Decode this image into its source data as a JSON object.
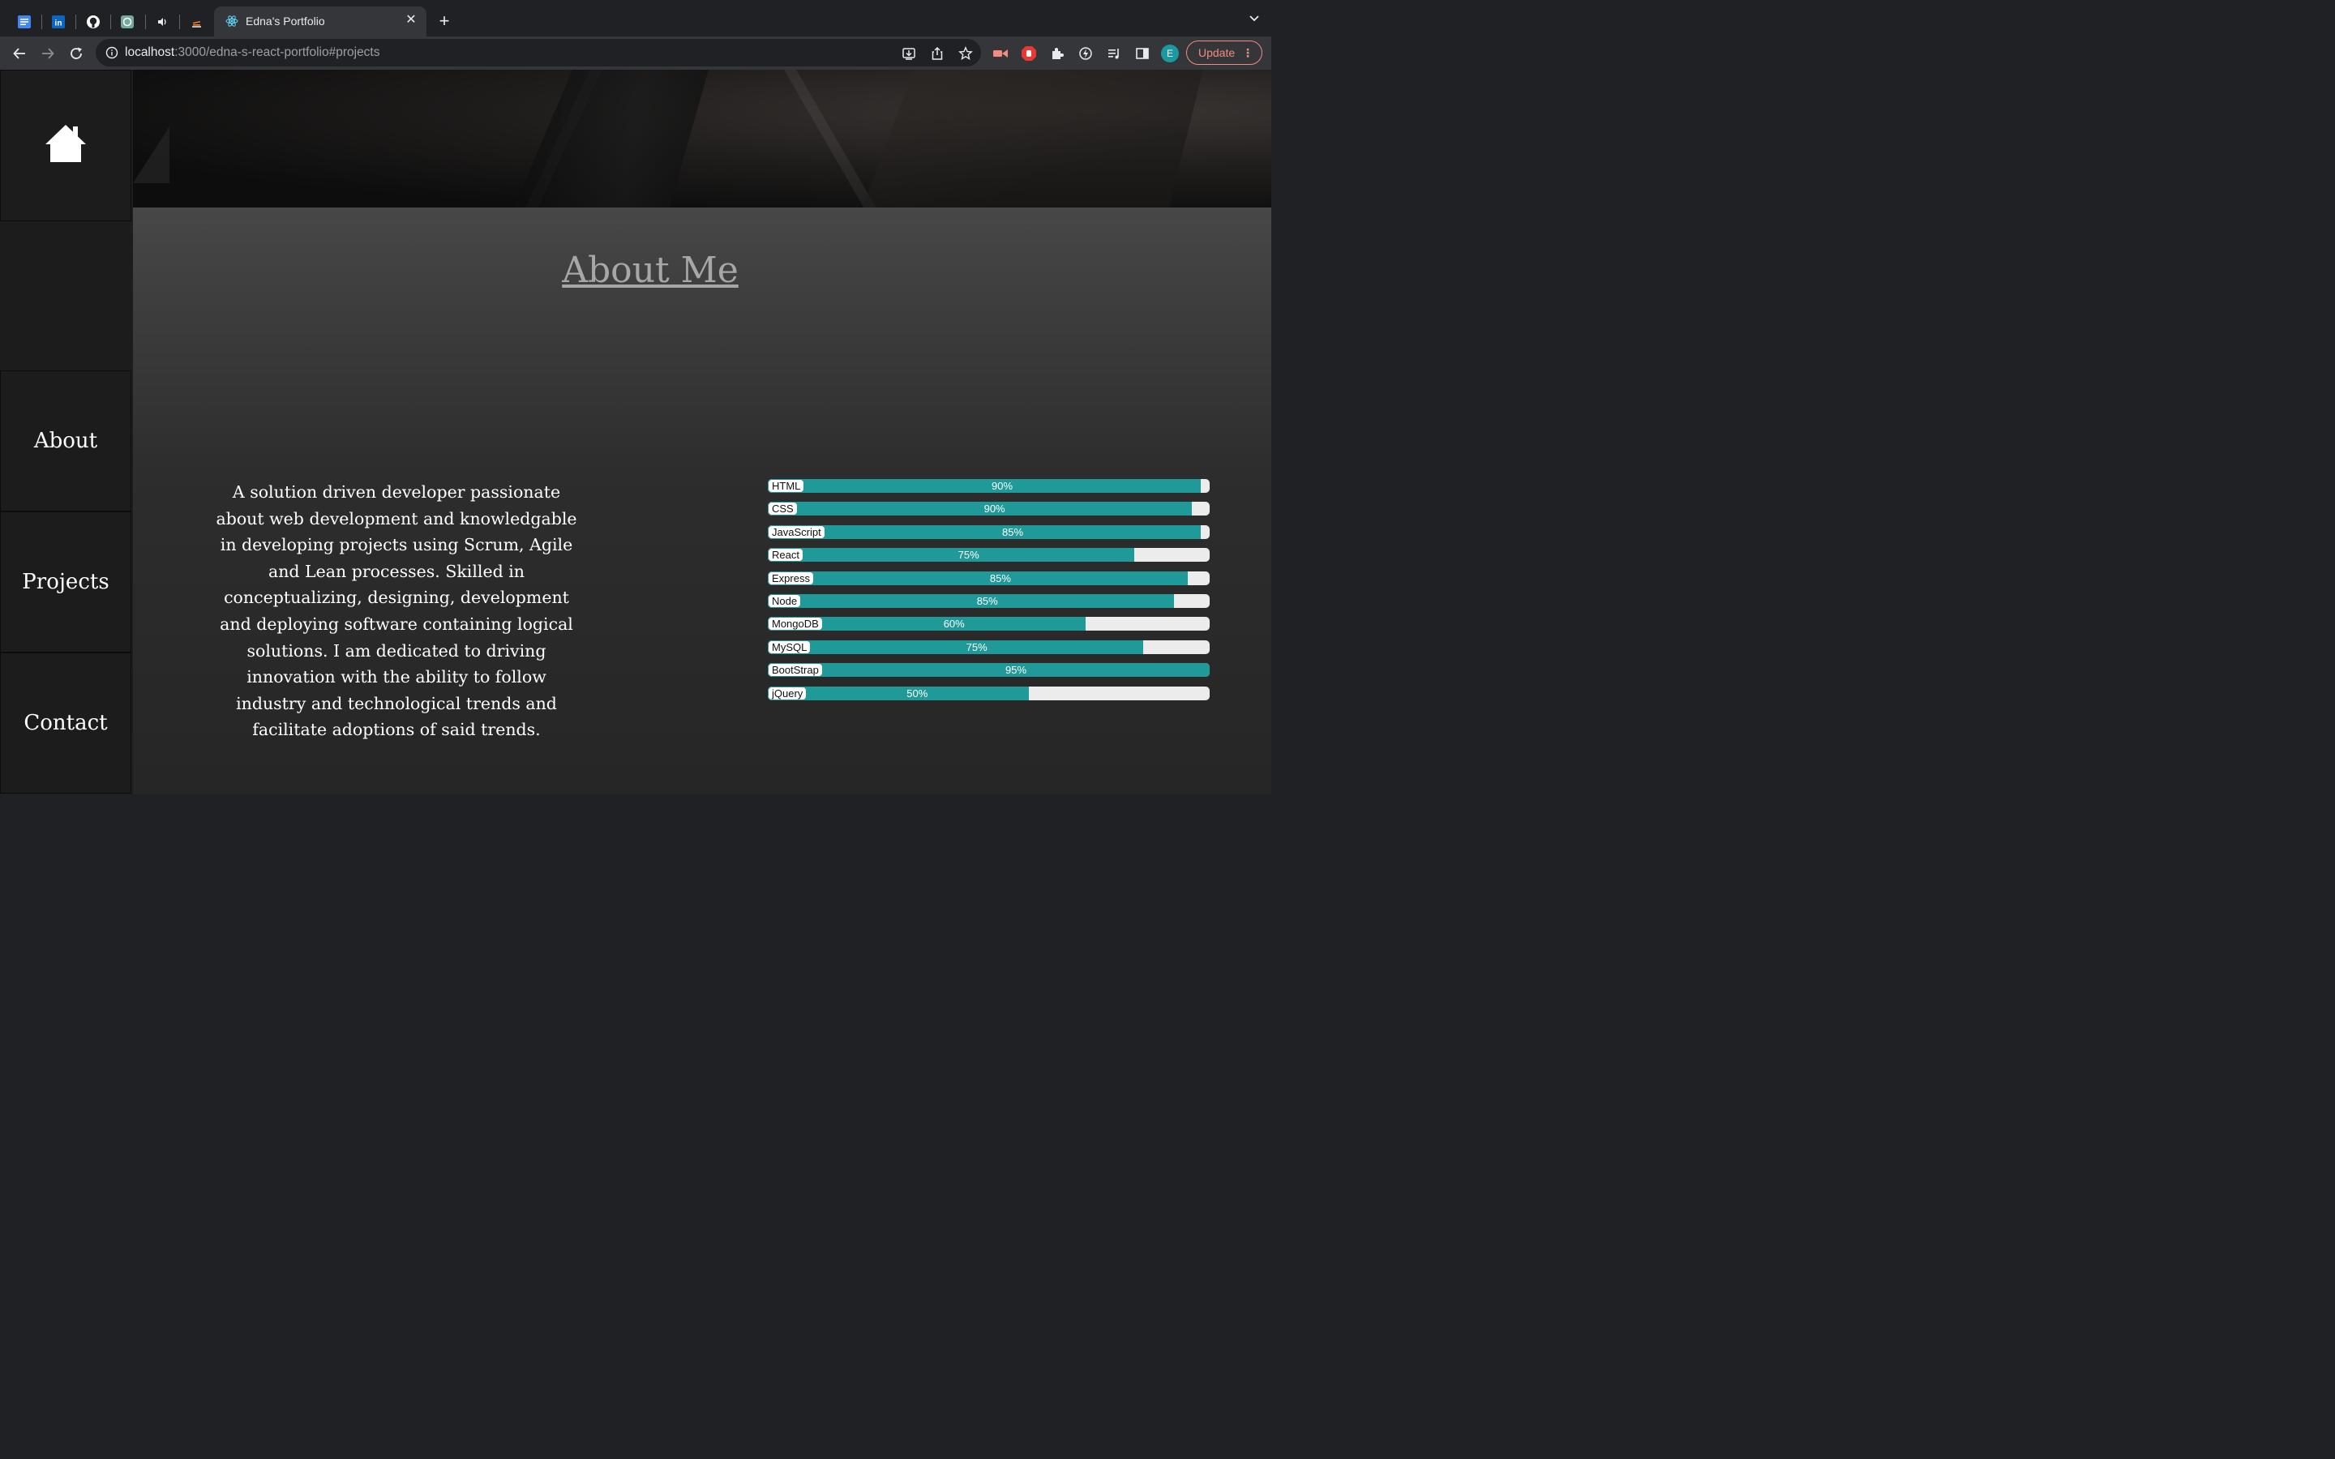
{
  "browser": {
    "pinned_tabs": [
      {
        "icon": "google-docs-icon",
        "color": "#4285f4"
      },
      {
        "icon": "linkedin-icon",
        "color": "#0a66c2"
      },
      {
        "icon": "github-icon",
        "color": "#ffffff"
      },
      {
        "icon": "chatgpt-icon",
        "color": "#74aa9c"
      },
      {
        "icon": "speaker-icon",
        "color": "#e8eaed"
      },
      {
        "icon": "stackoverflow-icon",
        "color": "#f48024"
      }
    ],
    "active_tab": {
      "title": "Edna's Portfolio",
      "icon": "react-icon"
    },
    "address": {
      "host": "localhost",
      "path": ":3000/edna-s-react-portfolio#projects"
    },
    "update_label": "Update",
    "profile_initial": "E"
  },
  "sidebar": {
    "home_icon": "home-icon",
    "items": [
      {
        "label": "About"
      },
      {
        "label": "Projects"
      },
      {
        "label": "Contact"
      }
    ]
  },
  "about": {
    "title": "About Me",
    "bio": "A solution driven developer passionate about web development and knowledgable in developing projects using Scrum, Agile and Lean processes. Skilled in conceptualizing, designing, development and deploying software containing logical solutions. I am dedicated to driving innovation with the ability to follow industry and technological trends and facilitate adoptions of said trends."
  },
  "skills": [
    {
      "name": "HTML",
      "label": "90%",
      "fill": 0.98
    },
    {
      "name": "CSS",
      "label": "90%",
      "fill": 0.96
    },
    {
      "name": "JavaScript",
      "label": "85%",
      "fill": 0.98
    },
    {
      "name": "React",
      "label": "75%",
      "fill": 0.83
    },
    {
      "name": "Express",
      "label": "85%",
      "fill": 0.95
    },
    {
      "name": "Node",
      "label": "85%",
      "fill": 0.92
    },
    {
      "name": "MongoDB",
      "label": "60%",
      "fill": 0.72
    },
    {
      "name": "MySQL",
      "label": "75%",
      "fill": 0.85
    },
    {
      "name": "BootStrap",
      "label": "95%",
      "fill": 1.0
    },
    {
      "name": "jQuery",
      "label": "50%",
      "fill": 0.59
    }
  ],
  "colors": {
    "skill_bar": "#1f9a98",
    "accent_update": "#f28b82"
  }
}
